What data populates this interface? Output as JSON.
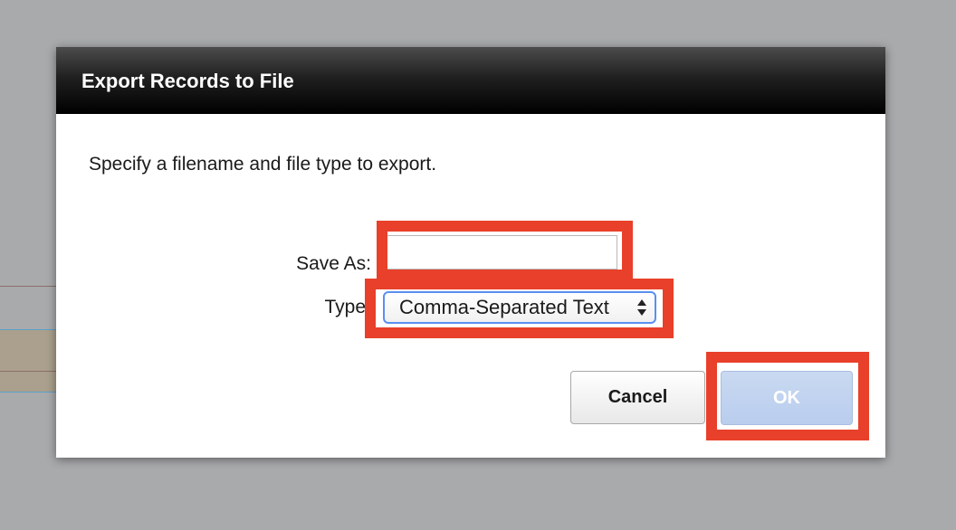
{
  "dialog": {
    "title": "Export Records to File",
    "instructions": "Specify a filename and file type to export.",
    "save_as": {
      "label": "Save As:",
      "value": "",
      "placeholder": ""
    },
    "type": {
      "label": "Type",
      "selected": "Comma-Separated Text"
    },
    "buttons": {
      "cancel": "Cancel",
      "ok": "OK"
    }
  },
  "colors": {
    "highlight": "#e8402a",
    "title_bar": "#000000",
    "ok_button": "#c2d4ef",
    "select_focus": "#5b8ff0",
    "backdrop": "#a9aaac"
  },
  "icons": {
    "select_arrows": "up-down-arrows-icon"
  }
}
